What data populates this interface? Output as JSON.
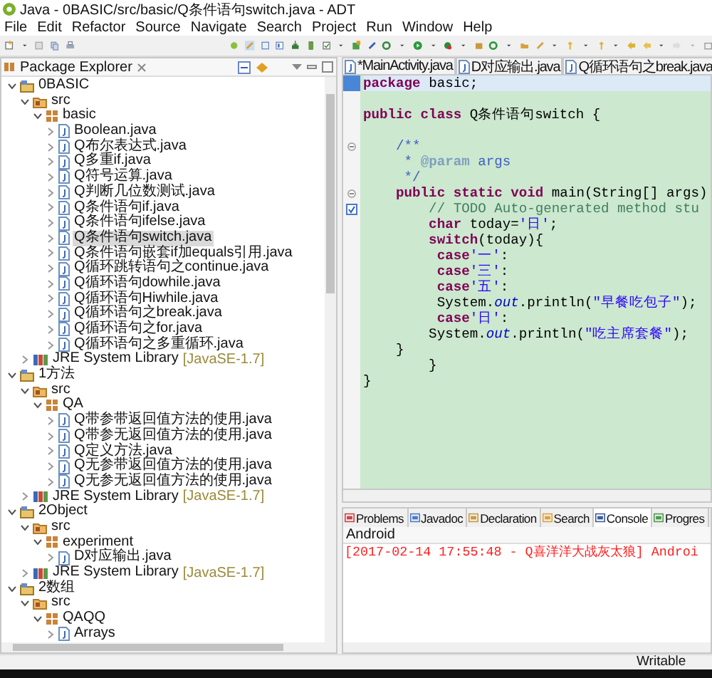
{
  "window": {
    "title": "Java - 0BASIC/src/basic/Q条件语句switch.java - ADT"
  },
  "menu": [
    "File",
    "Edit",
    "Refactor",
    "Source",
    "Navigate",
    "Search",
    "Project",
    "Run",
    "Window",
    "Help"
  ],
  "explorer": {
    "title": "Package Explorer",
    "tree": [
      {
        "kind": "project",
        "label": "0BASIC",
        "expanded": true,
        "selected": false,
        "children": [
          {
            "kind": "source-folder",
            "label": "src",
            "expanded": true,
            "selected": false,
            "children": [
              {
                "kind": "package",
                "label": "basic",
                "expanded": true,
                "selected": false,
                "children": [
                  {
                    "kind": "file",
                    "label": "Boolean.java",
                    "expanded": false,
                    "selected": false
                  },
                  {
                    "kind": "file",
                    "label": "Q布尔表达式.java",
                    "expanded": false,
                    "selected": false
                  },
                  {
                    "kind": "file",
                    "label": "Q多重if.java",
                    "expanded": false,
                    "selected": false
                  },
                  {
                    "kind": "file",
                    "label": "Q符号运算.java",
                    "expanded": false,
                    "selected": false
                  },
                  {
                    "kind": "file",
                    "label": "Q判断几位数测试.java",
                    "expanded": false,
                    "selected": false
                  },
                  {
                    "kind": "file",
                    "label": "Q条件语句if.java",
                    "expanded": false,
                    "selected": false
                  },
                  {
                    "kind": "file",
                    "label": "Q条件语句ifelse.java",
                    "expanded": false,
                    "selected": false
                  },
                  {
                    "kind": "file",
                    "label": "Q条件语句switch.java",
                    "expanded": false,
                    "selected": true
                  },
                  {
                    "kind": "file",
                    "label": "Q条件语句嵌套if加equals引用.java",
                    "expanded": false,
                    "selected": false
                  },
                  {
                    "kind": "file",
                    "label": "Q循环跳转语句之continue.java",
                    "expanded": false,
                    "selected": false
                  },
                  {
                    "kind": "file",
                    "label": "Q循环语句dowhile.java",
                    "expanded": false,
                    "selected": false
                  },
                  {
                    "kind": "file",
                    "label": "Q循环语句Hiwhile.java",
                    "expanded": false,
                    "selected": false
                  },
                  {
                    "kind": "file",
                    "label": "Q循环语句之break.java",
                    "expanded": false,
                    "selected": false
                  },
                  {
                    "kind": "file",
                    "label": "Q循环语句之for.java",
                    "expanded": false,
                    "selected": false
                  },
                  {
                    "kind": "file",
                    "label": "Q循环语句之多重循环.java",
                    "expanded": false,
                    "selected": false
                  }
                ]
              }
            ]
          },
          {
            "kind": "library",
            "label": "JRE System Library",
            "decoration": "[JavaSE-1.7]",
            "expanded": false,
            "selected": false
          }
        ]
      },
      {
        "kind": "project",
        "label": "1方法",
        "expanded": true,
        "selected": false,
        "children": [
          {
            "kind": "source-folder",
            "label": "src",
            "expanded": true,
            "selected": false,
            "children": [
              {
                "kind": "package",
                "label": "QA",
                "expanded": true,
                "selected": false,
                "children": [
                  {
                    "kind": "file",
                    "label": "Q带参带返回值方法的使用.java",
                    "expanded": false,
                    "selected": false
                  },
                  {
                    "kind": "file",
                    "label": "Q带参无返回值方法的使用.java",
                    "expanded": false,
                    "selected": false
                  },
                  {
                    "kind": "file",
                    "label": "Q定义方法.java",
                    "expanded": false,
                    "selected": false
                  },
                  {
                    "kind": "file",
                    "label": "Q无参带返回值方法的使用.java",
                    "expanded": false,
                    "selected": false
                  },
                  {
                    "kind": "file",
                    "label": "Q无参无返回值方法的使用.java",
                    "expanded": false,
                    "selected": false
                  }
                ]
              }
            ]
          },
          {
            "kind": "library",
            "label": "JRE System Library",
            "decoration": "[JavaSE-1.7]",
            "expanded": false,
            "selected": false
          }
        ]
      },
      {
        "kind": "project",
        "label": "2Object",
        "expanded": true,
        "selected": false,
        "children": [
          {
            "kind": "source-folder",
            "label": "src",
            "expanded": true,
            "selected": false,
            "children": [
              {
                "kind": "package",
                "label": "experiment",
                "expanded": true,
                "selected": false,
                "children": [
                  {
                    "kind": "file",
                    "label": "D对应输出.java",
                    "expanded": false,
                    "selected": false
                  }
                ]
              }
            ]
          },
          {
            "kind": "library",
            "label": "JRE System Library",
            "decoration": "[JavaSE-1.7]",
            "expanded": false,
            "selected": false
          }
        ]
      },
      {
        "kind": "project",
        "label": "2数组",
        "expanded": true,
        "selected": false,
        "children": [
          {
            "kind": "source-folder",
            "label": "src",
            "expanded": true,
            "selected": false,
            "children": [
              {
                "kind": "package",
                "label": "QAQQ",
                "expanded": true,
                "selected": false,
                "children": [
                  {
                    "kind": "file",
                    "label": "Arrays",
                    "expanded": false,
                    "selected": false
                  }
                ]
              }
            ]
          }
        ]
      }
    ]
  },
  "editor": {
    "tabs": [
      {
        "label": "*MainActivity.java",
        "selected": false
      },
      {
        "label": "D对应输出.java",
        "selected": false
      },
      {
        "label": "Q循环语句之break.java",
        "selected": false
      }
    ],
    "lines": [
      {
        "current": true,
        "kind": "plain",
        "tokens": [
          {
            "kind": "keyword",
            "text": "package"
          },
          {
            "kind": "plain",
            "text": " basic;"
          }
        ]
      },
      {
        "current": false,
        "kind": "blank"
      },
      {
        "current": false,
        "kind": "plain",
        "tokens": [
          {
            "kind": "keyword",
            "text": "public class"
          },
          {
            "kind": "plain",
            "text": " Q条件语句switch {"
          }
        ]
      },
      {
        "current": false,
        "kind": "blank"
      },
      {
        "current": false,
        "kind": "foldable",
        "tokens": [
          {
            "kind": "javadoc",
            "text": "    /**"
          }
        ]
      },
      {
        "current": false,
        "tokens": [
          {
            "kind": "javadoc",
            "text": "     * "
          },
          {
            "kind": "tag",
            "text": "@param"
          },
          {
            "kind": "javadoc",
            "text": " args"
          }
        ]
      },
      {
        "current": false,
        "tokens": [
          {
            "kind": "javadoc",
            "text": "     */"
          }
        ]
      },
      {
        "current": false,
        "kind": "foldable",
        "tokens": [
          {
            "kind": "keyword",
            "text": "    public static void"
          },
          {
            "kind": "plain",
            "text": " main(String[] args)"
          }
        ]
      },
      {
        "current": false,
        "kind": "task",
        "tokens": [
          {
            "kind": "comment",
            "text": "        // TODO Auto-generated method stu"
          }
        ]
      },
      {
        "current": false,
        "tokens": [
          {
            "kind": "keyword",
            "text": "        char"
          },
          {
            "kind": "plain",
            "text": " today="
          },
          {
            "kind": "string",
            "text": "'日'"
          },
          {
            "kind": "plain",
            "text": ";"
          }
        ]
      },
      {
        "current": false,
        "tokens": [
          {
            "kind": "keyword",
            "text": "        switch"
          },
          {
            "kind": "plain",
            "text": "(today){"
          }
        ]
      },
      {
        "current": false,
        "tokens": [
          {
            "kind": "keyword",
            "text": "         case"
          },
          {
            "kind": "string",
            "text": "'一'"
          },
          {
            "kind": "plain",
            "text": ":"
          }
        ]
      },
      {
        "current": false,
        "tokens": [
          {
            "kind": "keyword",
            "text": "         case"
          },
          {
            "kind": "string",
            "text": "'三'"
          },
          {
            "kind": "plain",
            "text": ":"
          }
        ]
      },
      {
        "current": false,
        "tokens": [
          {
            "kind": "keyword",
            "text": "         case"
          },
          {
            "kind": "string",
            "text": "'五'"
          },
          {
            "kind": "plain",
            "text": ":"
          }
        ]
      },
      {
        "current": false,
        "tokens": [
          {
            "kind": "plain",
            "text": "         System."
          },
          {
            "kind": "field",
            "text": "out"
          },
          {
            "kind": "plain",
            "text": ".println("
          },
          {
            "kind": "string",
            "text": "\"早餐吃包子\""
          },
          {
            "kind": "plain",
            "text": ");"
          }
        ]
      },
      {
        "current": false,
        "tokens": [
          {
            "kind": "keyword",
            "text": "         case"
          },
          {
            "kind": "string",
            "text": "'日'"
          },
          {
            "kind": "plain",
            "text": ":"
          }
        ]
      },
      {
        "current": false,
        "tokens": [
          {
            "kind": "plain",
            "text": "        System."
          },
          {
            "kind": "field",
            "text": "out"
          },
          {
            "kind": "plain",
            "text": ".println("
          },
          {
            "kind": "string",
            "text": "\"吃主席套餐\""
          },
          {
            "kind": "plain",
            "text": ");"
          }
        ]
      },
      {
        "current": false,
        "tokens": [
          {
            "kind": "plain",
            "text": "    }"
          }
        ]
      },
      {
        "current": false,
        "tokens": [
          {
            "kind": "plain",
            "text": "        }"
          }
        ]
      },
      {
        "current": false,
        "tokens": [
          {
            "kind": "plain",
            "text": "}"
          }
        ]
      }
    ]
  },
  "views": [
    {
      "kind": "problems",
      "label": "Problems",
      "selected": false
    },
    {
      "kind": "javadoc",
      "label": "Javadoc",
      "selected": false
    },
    {
      "kind": "declaration",
      "label": "Declaration",
      "selected": false
    },
    {
      "kind": "search",
      "label": "Search",
      "selected": false
    },
    {
      "kind": "console",
      "label": "Console",
      "selected": true
    },
    {
      "kind": "progress",
      "label": "Progres",
      "selected": false
    }
  ],
  "console": {
    "name": "Android",
    "lines": [
      {
        "kind": "error",
        "text": "[2017-02-14 17:55:48 - Q喜洋洋大战灰太狼] Androi"
      }
    ]
  },
  "status_bar": {
    "mode": "Writable"
  }
}
